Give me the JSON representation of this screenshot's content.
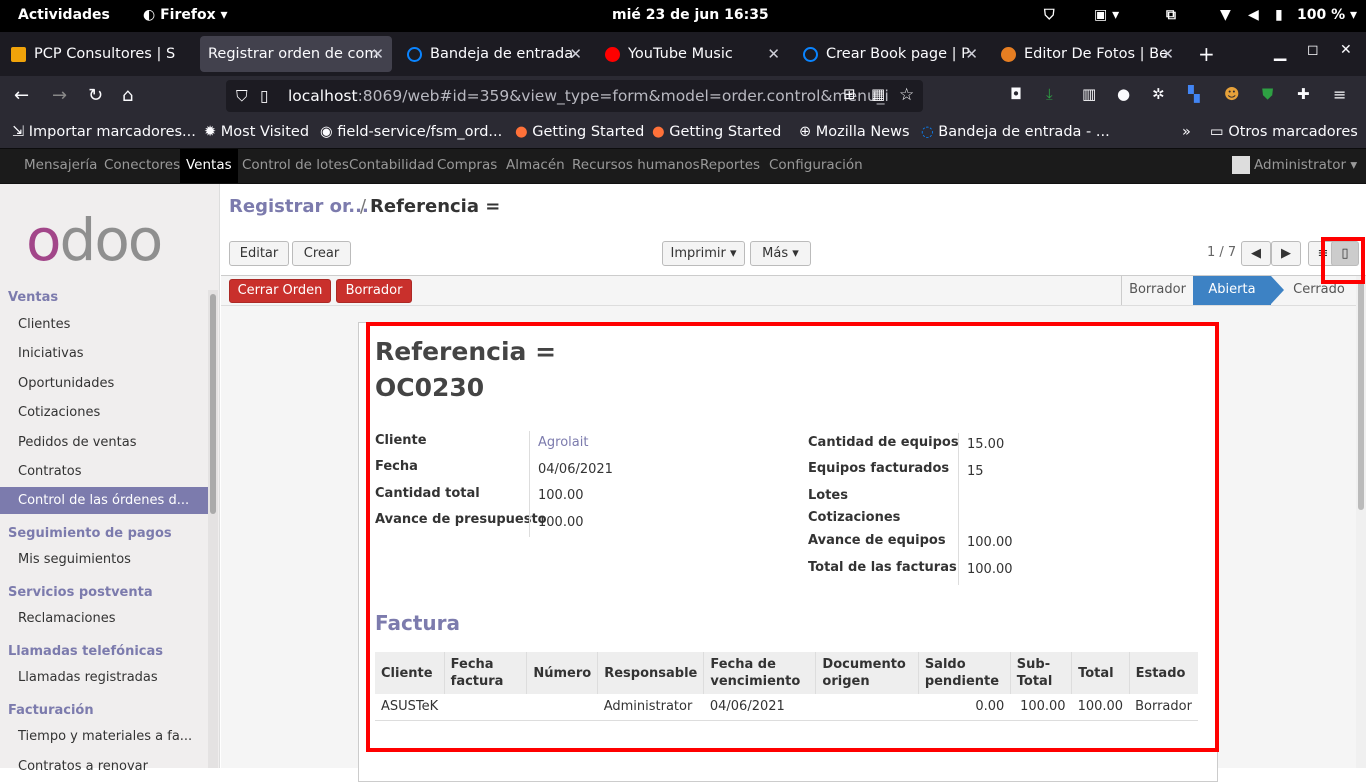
{
  "gnome": {
    "activities": "Actividades",
    "app": "Firefox",
    "clock": "mié 23 de jun  16:35",
    "battery": "100 %"
  },
  "tabs": [
    {
      "label": "PCP Consultores | S",
      "color": "#f0a30a"
    },
    {
      "label": "Registrar orden de com",
      "color": "#42414d"
    },
    {
      "label": "Bandeja de entrada",
      "color": "#0a84ff"
    },
    {
      "label": "YouTube Music",
      "color": "#ff0000"
    },
    {
      "label": "Crear Book page | P",
      "color": "#0a84ff"
    },
    {
      "label": "Editor De Fotos | Be",
      "color": "#e67e22"
    }
  ],
  "url": {
    "host": "localhost",
    "rest": ":8069/web#id=359&view_type=form&model=order.control&menu_i"
  },
  "bookmarks": [
    "Importar marcadores...",
    "Most Visited",
    "field-service/fsm_ord...",
    "Getting Started",
    "Getting Started",
    "Mozilla News",
    "Bandeja de entrada - ...",
    "Otros marcadores"
  ],
  "odoo_menu": [
    "Mensajería",
    "Conectores",
    "Ventas",
    "Control de lotes",
    "Contabilidad",
    "Compras",
    "Almacén",
    "Recursos humanos",
    "Reportes",
    "Configuración"
  ],
  "user": "Administrator",
  "logo": "odoo",
  "sidebar": {
    "ventas": "Ventas",
    "items": [
      "Clientes",
      "Iniciativas",
      "Oportunidades",
      "Cotizaciones",
      "Pedidos de ventas",
      "Contratos",
      "Control de las órdenes d..."
    ],
    "seg": "Seguimiento de pagos",
    "seg_items": [
      "Mis seguimientos"
    ],
    "post": "Servicios postventa",
    "post_items": [
      "Reclamaciones"
    ],
    "llam": "Llamadas telefónicas",
    "llam_items": [
      "Llamadas registradas"
    ],
    "fact": "Facturación",
    "fact_items": [
      "Tiempo y materiales a fa...",
      "Contratos a renovar"
    ]
  },
  "breadcrumb": {
    "parent": "Registrar or...",
    "current": "Referencia ="
  },
  "buttons": {
    "edit": "Editar",
    "create": "Crear",
    "print": "Imprimir",
    "more": "Más",
    "pager": "1 / 7",
    "close_order": "Cerrar Orden",
    "draft": "Borrador"
  },
  "stages": [
    "Borrador",
    "Abierta",
    "Cerrado"
  ],
  "form": {
    "title1": "Referencia =",
    "title2": "OC0230",
    "left": [
      {
        "label": "Cliente",
        "value": "Agrolait"
      },
      {
        "label": "Fecha",
        "value": "04/06/2021"
      },
      {
        "label": "Cantidad total",
        "value": "100.00"
      },
      {
        "label": "Avance de presupuesto",
        "value": "100.00"
      }
    ],
    "right": [
      {
        "label": "Cantidad de equipos",
        "value": "15.00"
      },
      {
        "label": "Equipos facturados",
        "value": "15"
      },
      {
        "label": "Lotes",
        "value": ""
      },
      {
        "label": "Cotizaciones",
        "value": ""
      },
      {
        "label": "Avance de equipos",
        "value": "100.00"
      },
      {
        "label": "Total de las facturas",
        "value": "100.00"
      }
    ],
    "section": "Factura",
    "table": {
      "headers": [
        "Cliente",
        "Fecha factura",
        "Número",
        "Responsable",
        "Fecha de vencimiento",
        "Documento origen",
        "Saldo pendiente",
        "Sub-Total",
        "Total",
        "Estado"
      ],
      "rows": [
        [
          "ASUSTeK",
          "",
          "",
          "Administrator",
          "04/06/2021",
          "",
          "0.00",
          "100.00",
          "100.00",
          "Borrador"
        ]
      ]
    }
  }
}
